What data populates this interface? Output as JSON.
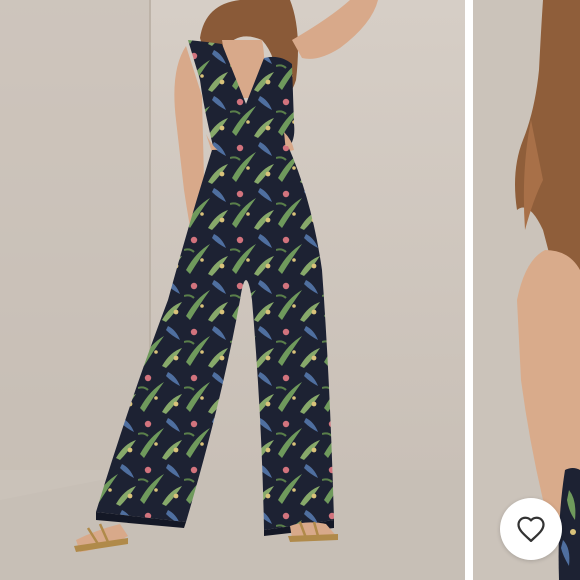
{
  "gallery": {
    "current_slide": "tropical-print-jumpsuit-front",
    "next_slide": "tropical-print-jumpsuit-detail"
  },
  "favorite_button": {
    "icon": "heart-icon",
    "state": "not-favorited"
  },
  "colors": {
    "backdrop": "#cfc7bf",
    "floor": "#c7bfb6",
    "garment_base": "#1d2233",
    "leaf_green": "#6f9a5c",
    "leaf_blue": "#4f6fa0",
    "flower_pink": "#d2737d",
    "flower_yellow": "#d9c27a",
    "skin": "#d8a98a",
    "hair": "#8a5a38"
  }
}
